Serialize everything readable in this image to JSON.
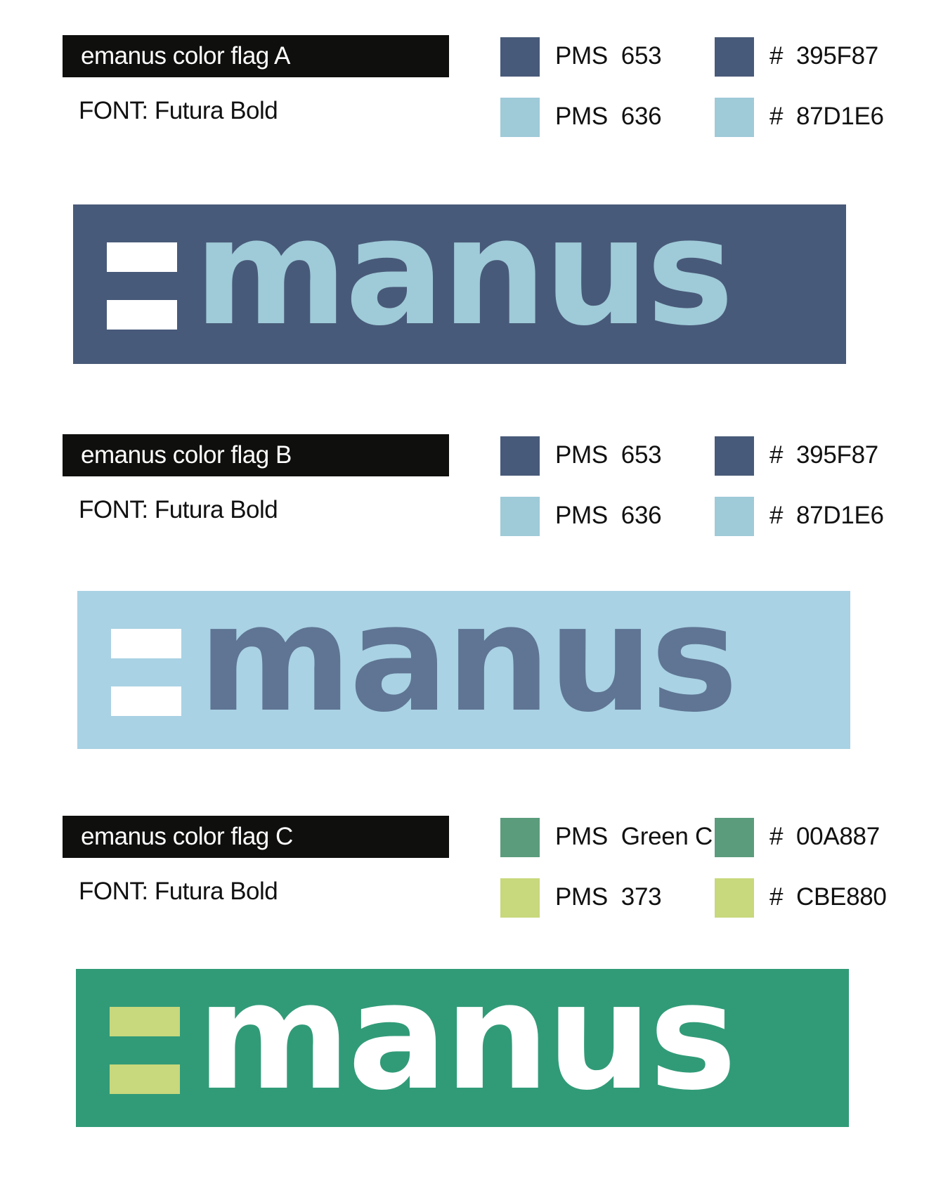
{
  "flags": [
    {
      "label": "emanus color flag A",
      "font": "FONT: Futura Bold",
      "swatches": [
        {
          "pms": "PMS  653",
          "hex": "#  395F87",
          "color": "#485a79"
        },
        {
          "pms": "PMS  636",
          "hex": "#  87D1E6",
          "color": "#9fcad8"
        }
      ],
      "banner": {
        "bg": "#485a79",
        "bars": "#ffffff",
        "text_color": "#9fcad8",
        "word": "manus"
      }
    },
    {
      "label": "emanus color flag B",
      "font": "FONT: Futura Bold",
      "swatches": [
        {
          "pms": "PMS  653",
          "hex": "#  395F87",
          "color": "#485a79"
        },
        {
          "pms": "PMS  636",
          "hex": "#  87D1E6",
          "color": "#9fcad8"
        }
      ],
      "banner": {
        "bg": "#a9d2e4",
        "bars": "#ffffff",
        "text_color": "#5f7593",
        "word": "manus"
      }
    },
    {
      "label": "emanus color flag C",
      "font": "FONT: Futura Bold",
      "swatches": [
        {
          "pms": "PMS  Green C",
          "hex": "#  00A887",
          "color": "#5b9c7d"
        },
        {
          "pms": "PMS  373",
          "hex": "#  CBE880",
          "color": "#c8d87c"
        }
      ],
      "banner": {
        "bg": "#319b78",
        "bars": "#c8d87c",
        "text_color": "#ffffff",
        "word": "manus"
      }
    }
  ]
}
